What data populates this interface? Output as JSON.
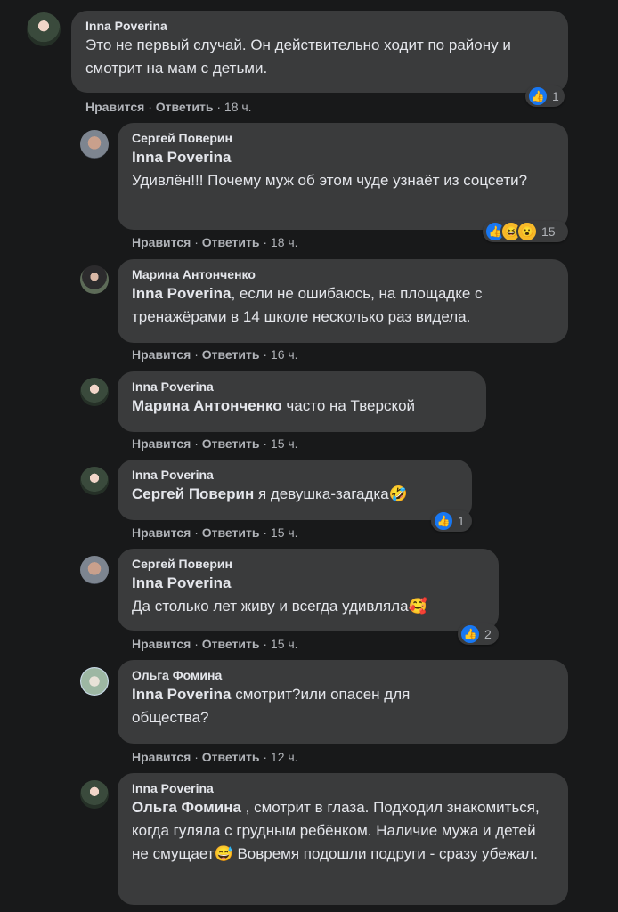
{
  "comments": [
    {
      "author": "Inna Poverina",
      "text": "Это не первый случай. Он действительно ходит по району и смотрит на мам с детьми.",
      "like": "Нравится",
      "reply": "Ответить",
      "time": "18 ч.",
      "reactions": "1"
    },
    {
      "author": "Сергей Поверин",
      "mention": "Inna Poverina",
      "text": "Удивлён!!! Почему муж об этом чуде узнаёт из соцсети?",
      "like": "Нравится",
      "reply": "Ответить",
      "time": "18 ч.",
      "reactions": "15"
    },
    {
      "author": "Марина Антонченко",
      "mention": "Inna Poverina",
      "text": ", если не ошибаюсь, на площадке с тренажёрами в 14 школе несколько раз видела.",
      "like": "Нравится",
      "reply": "Ответить",
      "time": "16 ч."
    },
    {
      "author": "Inna Poverina",
      "mention": "Марина Антонченко",
      "text": "часто на Тверской",
      "like": "Нравится",
      "reply": "Ответить",
      "time": "15 ч."
    },
    {
      "author": "Inna Poverina",
      "mention": "Сергей Поверин",
      "text": "я девушка-загадка🤣",
      "like": "Нравится",
      "reply": "Ответить",
      "time": "15 ч.",
      "reactions": "1"
    },
    {
      "author": "Сергей Поверин",
      "mention": "Inna Poverina",
      "text": "Да столько лет живу и всегда удивляла🥰",
      "like": "Нравится",
      "reply": "Ответить",
      "time": "15 ч.",
      "reactions": "2"
    },
    {
      "author": "Ольга Фомина",
      "mention": "Inna Poverina",
      "text": "смотрит?или опасен для общества?",
      "like": "Нравится",
      "reply": "Ответить",
      "time": "12 ч."
    },
    {
      "author": "Inna Poverina",
      "mention": "Ольга Фомина",
      "text": ", смотрит в глаза. Подходил знакомиться, когда гуляла с грудным ребёнком. Наличие мужа и детей не смущает😅 Вовремя подошли подруги - сразу убежал."
    }
  ],
  "separator": "·",
  "colors": {
    "background": "#18191a",
    "bubble": "#3a3b3c",
    "like": "#1877f2"
  }
}
